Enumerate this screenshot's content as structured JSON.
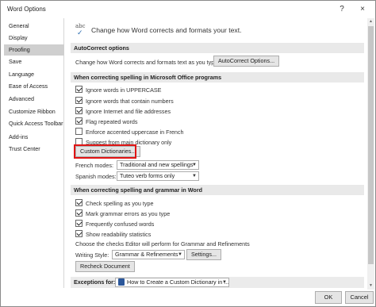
{
  "window": {
    "title": "Word Options",
    "help": "?",
    "close": "×"
  },
  "sidebar": {
    "items": [
      {
        "label": "General"
      },
      {
        "label": "Display"
      },
      {
        "label": "Proofing",
        "active": true
      },
      {
        "label": "Save"
      },
      {
        "label": "Language"
      },
      {
        "label": "Ease of Access"
      },
      {
        "label": "Advanced"
      },
      {
        "label": "Customize Ribbon"
      },
      {
        "label": "Quick Access Toolbar"
      },
      {
        "label": "Add-ins"
      },
      {
        "label": "Trust Center"
      }
    ]
  },
  "header": {
    "icon_text": "abc",
    "text": "Change how Word corrects and formats your text."
  },
  "autocorrect": {
    "section": "AutoCorrect options",
    "desc": "Change how Word corrects and formats text as you type:",
    "button": "AutoCorrect Options..."
  },
  "office_spelling": {
    "section": "When correcting spelling in Microsoft Office programs",
    "options": [
      {
        "label": "Ignore words in UPPERCASE",
        "checked": true
      },
      {
        "label": "Ignore words that contain numbers",
        "checked": true
      },
      {
        "label": "Ignore Internet and file addresses",
        "checked": true
      },
      {
        "label": "Flag repeated words",
        "checked": true
      },
      {
        "label": "Enforce accented uppercase in French",
        "checked": false
      },
      {
        "label": "Suggest from main dictionary only",
        "checked": false
      }
    ],
    "custom_dict_button": "Custom Dictionaries...",
    "french_modes_label": "French modes:",
    "french_modes_value": "Traditional and new spellings",
    "spanish_modes_label": "Spanish modes:",
    "spanish_modes_value": "Tuteo verb forms only"
  },
  "word_spelling": {
    "section": "When correcting spelling and grammar in Word",
    "options": [
      {
        "label": "Check spelling as you type",
        "checked": true
      },
      {
        "label": "Mark grammar errors as you type",
        "checked": true
      },
      {
        "label": "Frequently confused words",
        "checked": true
      },
      {
        "label": "Show readability statistics",
        "checked": true
      }
    ],
    "editor_desc": "Choose the checks Editor will perform for Grammar and Refinements",
    "writing_style_label": "Writing Style:",
    "writing_style_value": "Grammar & Refinements",
    "settings_button": "Settings...",
    "recheck_button": "Recheck Document"
  },
  "exceptions": {
    "label": "Exceptions for:",
    "document": "How to Create a Custom Dictionary in ..."
  },
  "footer": {
    "ok": "OK",
    "cancel": "Cancel"
  },
  "colors": {
    "highlight": "#e01414",
    "active_nav": "#cfcfcf",
    "section_bg": "#e9e9e9"
  }
}
